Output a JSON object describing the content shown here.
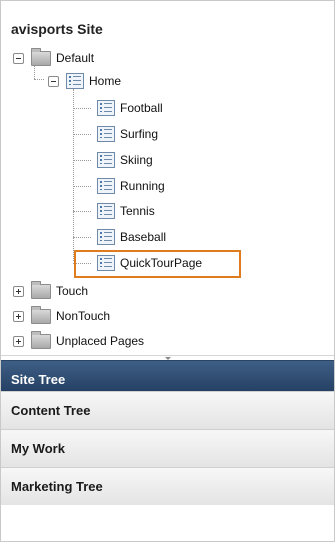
{
  "site": {
    "title": "avisports Site"
  },
  "tree": {
    "default": {
      "label": "Default"
    },
    "home": {
      "label": "Home"
    },
    "home_children": [
      "Football",
      "Surfing",
      "Skiing",
      "Running",
      "Tennis",
      "Baseball",
      "QuickTourPage"
    ],
    "siblings": [
      "Touch",
      "NonTouch",
      "Unplaced Pages"
    ]
  },
  "accordion": {
    "tabs": [
      "Site Tree",
      "Content Tree",
      "My Work",
      "Marketing Tree"
    ],
    "active": "Site Tree"
  },
  "colors": {
    "highlight_border": "#e07b1f",
    "active_tab_bg": "#2c4a6e"
  },
  "icons": {
    "expanded_toggle": "minus-toggle-icon",
    "collapsed_toggle": "plus-toggle-icon",
    "folder": "folder-icon",
    "page": "page-icon"
  }
}
